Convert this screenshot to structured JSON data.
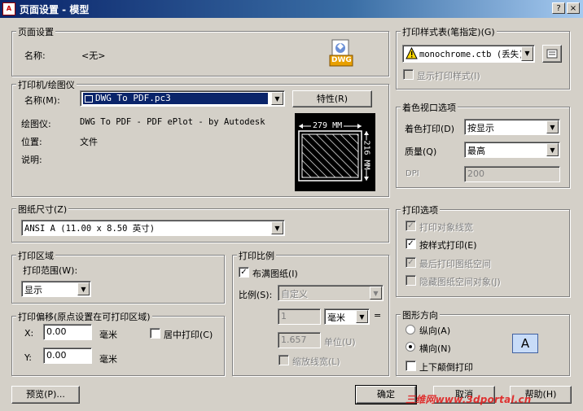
{
  "window": {
    "title": "页面设置 - 模型",
    "app_icon": "A",
    "help_btn": "?",
    "close_btn": "×"
  },
  "page_setup": {
    "legend": "页面设置",
    "name_label": "名称:",
    "name_value": "<无>",
    "dwg_badge": "DWG"
  },
  "printer": {
    "legend": "打印机/绘图仪",
    "name_label": "名称(M):",
    "name_value": "DWG To PDF.pc3",
    "properties_btn": "特性(R)",
    "plotter_label": "绘图仪:",
    "plotter_value": "DWG To PDF - PDF ePlot - by Autodesk",
    "location_label": "位置:",
    "location_value": "文件",
    "description_label": "说明:",
    "preview_width": "279 MM",
    "preview_height": "216 MM"
  },
  "paper_size": {
    "legend": "图纸尺寸(Z)",
    "value": "ANSI A (11.00 x 8.50 英寸)"
  },
  "plot_area": {
    "legend": "打印区域",
    "range_label": "打印范围(W):",
    "range_value": "显示"
  },
  "plot_offset": {
    "legend": "打印偏移(原点设置在可打印区域)",
    "x_label": "X:",
    "x_value": "0.00",
    "x_unit": "毫米",
    "y_label": "Y:",
    "y_value": "0.00",
    "y_unit": "毫米",
    "center_label": "居中打印(C)"
  },
  "plot_scale": {
    "legend": "打印比例",
    "fit_label": "布满图纸(I)",
    "scale_label": "比例(S):",
    "scale_value": "自定义",
    "value1": "1",
    "unit1": "毫米",
    "equals": "=",
    "value2": "1.657",
    "unit2": "单位(U)",
    "lineweight_label": "缩放线宽(L)"
  },
  "plot_style_table": {
    "legend": "打印样式表(笔指定)(G)",
    "value": "monochrome.ctb (丢失)",
    "show_label": "显示打印样式(I)"
  },
  "shaded_viewport": {
    "legend": "着色视口选项",
    "shade_label": "着色打印(D)",
    "shade_value": "按显示",
    "quality_label": "质量(Q)",
    "quality_value": "最高",
    "dpi_label": "DPI",
    "dpi_value": "200"
  },
  "plot_options": {
    "legend": "打印选项",
    "opt1": "打印对象线宽",
    "opt2": "按样式打印(E)",
    "opt3": "最后打印图纸空间",
    "opt4": "隐藏图纸空间对象(J)"
  },
  "orientation": {
    "legend": "图形方向",
    "portrait": "纵向(A)",
    "landscape": "横向(N)",
    "upside_down": "上下颠倒打印",
    "preview_letter": "A"
  },
  "buttons": {
    "preview": "预览(P)...",
    "ok": "确定",
    "cancel": "取消",
    "help": "帮助(H)"
  },
  "watermark": "三维网www.3dportal.cn"
}
